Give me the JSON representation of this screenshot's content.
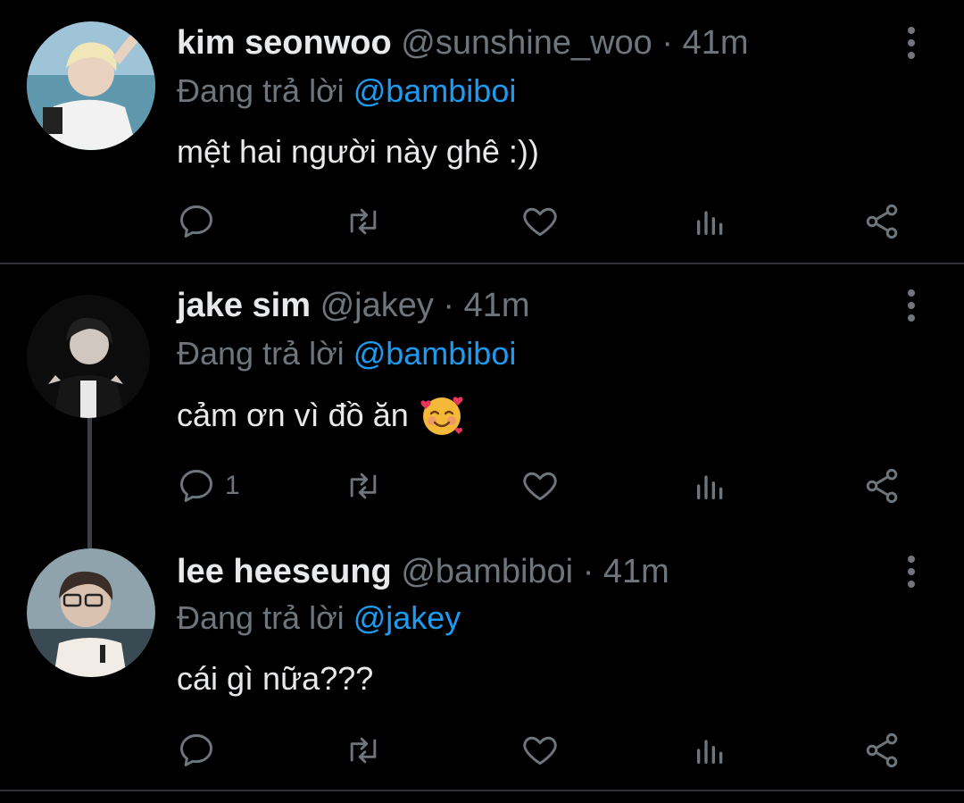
{
  "tweets": [
    {
      "name": "kim seonwoo",
      "handle": "@sunshine_woo",
      "time": "· 41m",
      "reply_prefix": "Đang trả lời",
      "reply_to": "@bambiboi",
      "text": "mệt hai người này ghê :))",
      "reply_count": ""
    },
    {
      "name": "jake sim",
      "handle": "@jakey",
      "time": "· 41m",
      "reply_prefix": "Đang trả lời",
      "reply_to": "@bambiboi",
      "text": "cảm ơn vì đồ ăn",
      "reply_count": "1"
    },
    {
      "name": "lee heeseung",
      "handle": "@bambiboi",
      "time": "· 41m",
      "reply_prefix": "Đang trả lời",
      "reply_to": "@jakey",
      "text": "cái gì nữa???",
      "reply_count": ""
    }
  ],
  "icons": {
    "reply": "reply-icon",
    "retweet": "retweet-icon",
    "like": "heart-icon",
    "views": "analytics-icon",
    "share": "share-icon",
    "more": "more-vertical-icon",
    "emoji": "smiling-face-with-hearts-emoji"
  },
  "colors": {
    "background": "#000000",
    "name": "#e7e9ea",
    "muted": "#6e767d",
    "mention": "#1d9bf0",
    "divider": "#2f3336"
  }
}
